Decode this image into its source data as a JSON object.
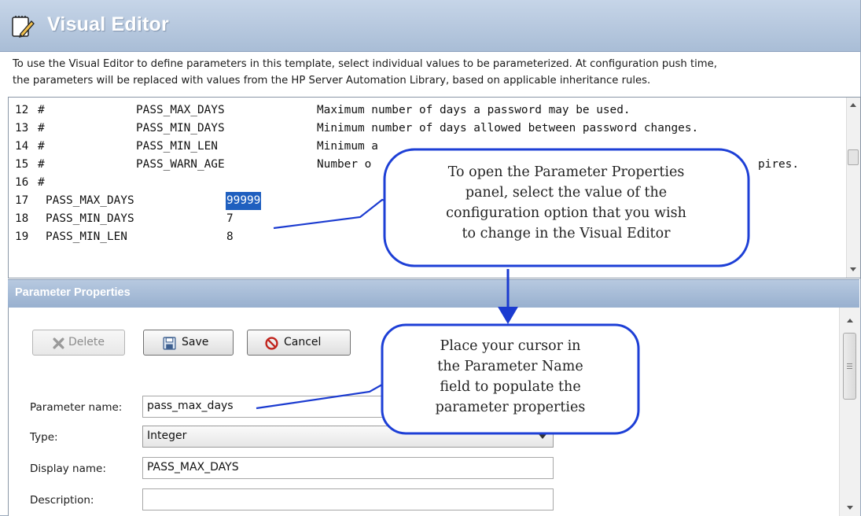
{
  "window": {
    "title": "Visual Editor",
    "icon": "notepad-pencil-icon",
    "intro_line1": "To use the Visual Editor to define parameters in this template, select individual values to be parameterized. At configuration push time,",
    "intro_line2": "the parameters will be replaced with values from the HP Server Automation Library, based on applicable inheritance rules."
  },
  "editor": {
    "comment_lines": [
      {
        "num": "12",
        "hash": "#",
        "key": "PASS_MAX_DAYS",
        "desc": "Maximum number of days a password may be used."
      },
      {
        "num": "13",
        "hash": "#",
        "key": "PASS_MIN_DAYS",
        "desc": "Minimum number of days allowed between password changes."
      },
      {
        "num": "14",
        "hash": "#",
        "key": "PASS_MIN_LEN",
        "desc": "Minimum a"
      },
      {
        "num": "15",
        "hash": "#",
        "key": "PASS_WARN_AGE",
        "desc": "Number o"
      },
      {
        "num": "16",
        "hash": "#",
        "key": "",
        "desc": ""
      }
    ],
    "setting_lines": [
      {
        "num": "17",
        "key": "PASS_MAX_DAYS",
        "value": "99999",
        "selected": true
      },
      {
        "num": "18",
        "key": "PASS_MIN_DAYS",
        "value": "7",
        "selected": false
      },
      {
        "num": "19",
        "key": "PASS_MIN_LEN",
        "value": "8",
        "selected": false
      }
    ],
    "line15_tail": "pires."
  },
  "panel": {
    "title": "Parameter Properties",
    "delete_label": "Delete",
    "save_label": "Save",
    "cancel_label": "Cancel",
    "fields": {
      "name_label": "Parameter name:",
      "name_value": "pass_max_days",
      "type_label": "Type:",
      "type_value": "Integer",
      "display_label": "Display name:",
      "display_value": "PASS_MAX_DAYS",
      "description_label": "Description:",
      "description_value": ""
    }
  },
  "callouts": {
    "top_line1": "To open the Parameter Properties",
    "top_line2": "panel, select the value of the",
    "top_line3": "configuration option that you wish",
    "top_line4": "to change in the Visual Editor",
    "bottom_line1": "Place your cursor in",
    "bottom_line2": "the Parameter Name",
    "bottom_line3": "field to populate the",
    "bottom_line4": "parameter properties"
  },
  "colors": {
    "titlebar": "#b5c7df",
    "selection": "#1f5fbf",
    "callout_border": "#1d3fd6",
    "arrow": "#1b3bd0"
  }
}
